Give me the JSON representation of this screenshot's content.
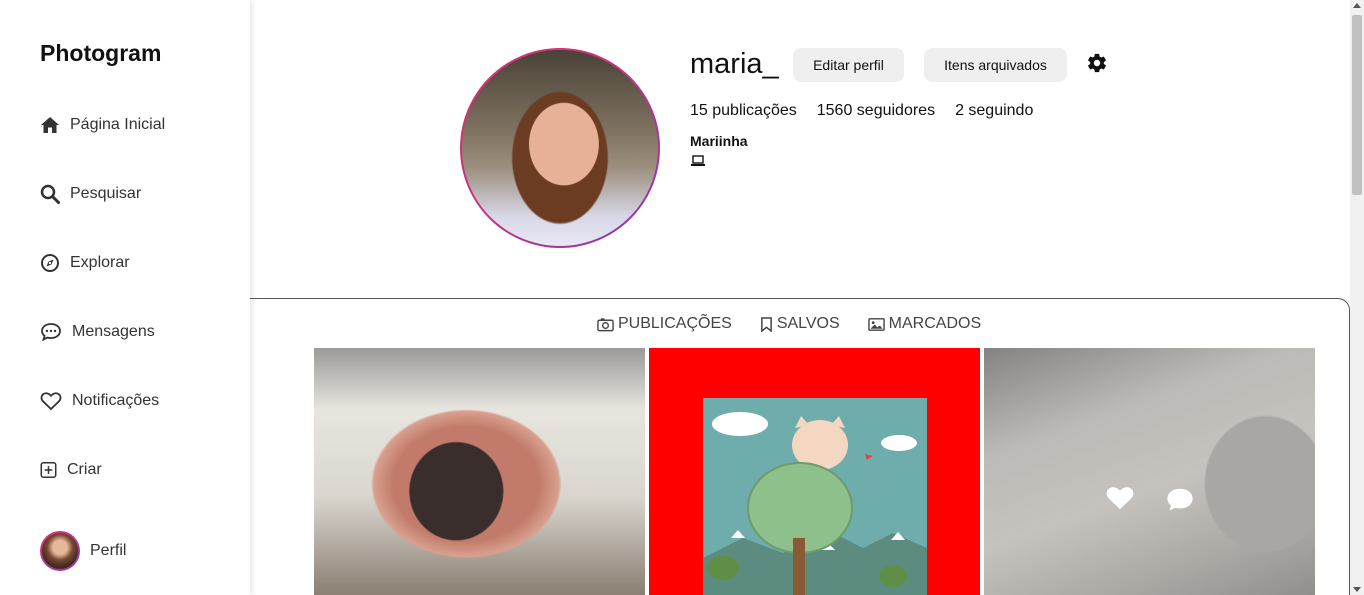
{
  "sidebar": {
    "logo": "Photogram",
    "items": [
      {
        "label": "Página Inicial",
        "icon": "home-icon"
      },
      {
        "label": "Pesquisar",
        "icon": "search-icon"
      },
      {
        "label": "Explorar",
        "icon": "compass-icon"
      },
      {
        "label": "Mensagens",
        "icon": "message-icon"
      },
      {
        "label": "Notificações",
        "icon": "heart-icon"
      },
      {
        "label": "Criar",
        "icon": "plus-square-icon"
      },
      {
        "label": "Perfil",
        "icon": "avatar"
      }
    ]
  },
  "profile": {
    "username": "maria_",
    "edit_label": "Editar perfil",
    "archived_label": "Itens arquivados",
    "stats": {
      "posts": "15 publicações",
      "followers": "1560 seguidores",
      "following": "2 seguindo"
    },
    "full_name": "Mariinha",
    "bio_icon": "laptop-icon"
  },
  "tabs": [
    {
      "label": "PUBLICAÇÕES",
      "icon": "camera-icon"
    },
    {
      "label": "SALVOS",
      "icon": "bookmark-icon"
    },
    {
      "label": "MARCADOS",
      "icon": "image-icon"
    }
  ],
  "posts": [
    {
      "subject": "cat nose close-up"
    },
    {
      "subject": "cartoon cat on tree"
    },
    {
      "subject": "gray kitten",
      "hover_icons": [
        "heart-icon",
        "comment-icon"
      ]
    }
  ],
  "colors": {
    "avatar_ring_start": "#e1306c",
    "avatar_ring_end": "#833ab4",
    "button_bg": "#efefef",
    "post2_bg": "#ff0000"
  }
}
